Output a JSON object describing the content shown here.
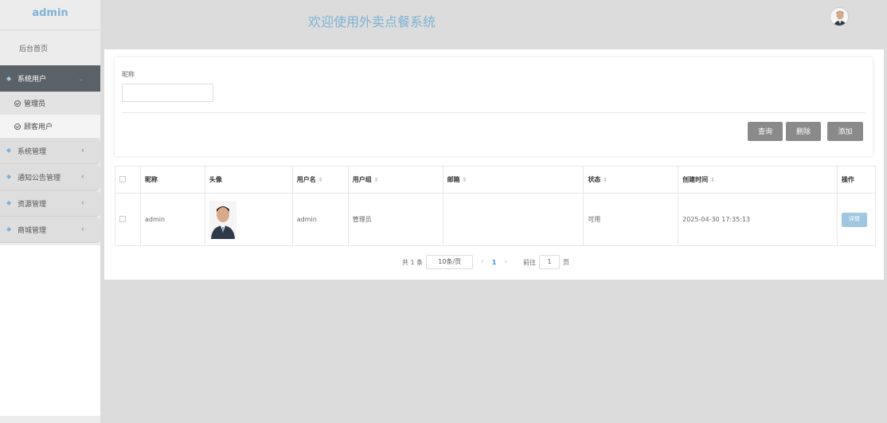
{
  "sidebar": {
    "logo": "admin",
    "home": "后台首页",
    "groups": [
      {
        "label": "系统用户",
        "active": true,
        "subs": [
          {
            "label": "管理员"
          },
          {
            "label": "顾客用户"
          }
        ]
      },
      {
        "label": "系统管理"
      },
      {
        "label": "通知公告管理"
      },
      {
        "label": "资源管理"
      },
      {
        "label": "商城管理"
      }
    ]
  },
  "header": {
    "title": "欢迎使用外卖点餐系统"
  },
  "filter": {
    "label": "昵称",
    "input_value": "",
    "buttons": {
      "query": "查询",
      "delete": "删除",
      "add": "添加"
    }
  },
  "table": {
    "columns": [
      "昵称",
      "头像",
      "用户名",
      "用户组",
      "邮箱",
      "状态",
      "创建时间",
      "操作"
    ],
    "rows": [
      {
        "nickname": "admin",
        "username": "admin",
        "group": "管理员",
        "email": "",
        "status": "可用",
        "created": "2025-04-30 17:35:13",
        "action": "详情"
      }
    ]
  },
  "pager": {
    "total": "共 1 条",
    "page_size": "10条/页",
    "current_page": "1",
    "goto_label": "前往",
    "goto_value": "1",
    "page_suffix": "页"
  },
  "colors": {
    "accent": "#7fb2d6",
    "button": "#8a8a8a",
    "active_nav": "#5a6268"
  }
}
